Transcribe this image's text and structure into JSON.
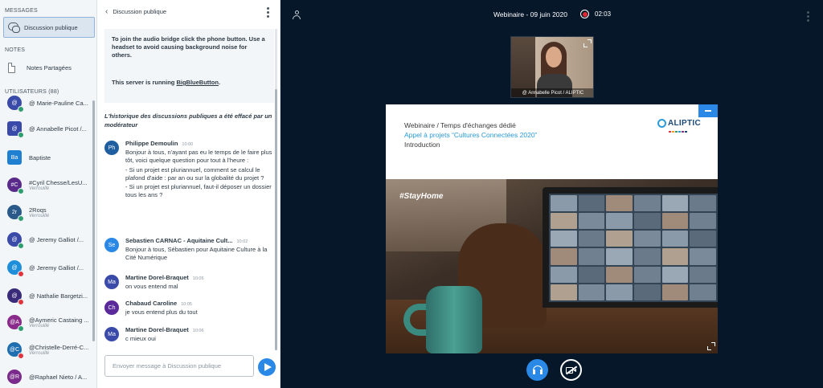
{
  "sidebar": {
    "messages_title": "MESSAGES",
    "public_chat_label": "Discussion publique",
    "notes_title": "NOTES",
    "shared_notes_label": "Notes Partagées",
    "users_title": "UTILISATEURS (88)",
    "users": [
      {
        "initials": "@",
        "name": "@ Marie-Pauline Ca...",
        "role": "",
        "color": "#3a4aa8",
        "badge_color": "#2f9e6e",
        "square": false
      },
      {
        "initials": "@",
        "name": "@ Annabelle Picot /...",
        "role": "",
        "color": "#3a4aa8",
        "badge_color": "#2f9e6e",
        "square": true
      },
      {
        "initials": "Ba",
        "name": "Baptiste",
        "role": "",
        "color": "#1f7fd1",
        "badge_color": "",
        "square": true
      },
      {
        "initials": "#C",
        "name": "#Cyril Chesse/LesU...",
        "role": "Verrouillé",
        "color": "#5a2a8a",
        "badge_color": "#2f9e6e",
        "square": false
      },
      {
        "initials": "2r",
        "name": "2Roqs",
        "role": "Verrouillé",
        "color": "#2a5a8a",
        "badge_color": "#2f9e6e",
        "square": false
      },
      {
        "initials": "@",
        "name": "@ Jeremy Galliot /...",
        "role": "",
        "color": "#3a4aa8",
        "badge_color": "#2f9e6e",
        "square": false
      },
      {
        "initials": "@",
        "name": "@ Jeremy Galliot /...",
        "role": "",
        "color": "#1f8fd9",
        "badge_color": "#e0353d",
        "square": false
      },
      {
        "initials": "@",
        "name": "@ Nathalie Bargetzi...",
        "role": "",
        "color": "#3a2a7a",
        "badge_color": "#e0353d",
        "square": false
      },
      {
        "initials": "@A",
        "name": "@Aymeric Castaing ...",
        "role": "Verrouillé",
        "color": "#8a2a8a",
        "badge_color": "#2f9e6e",
        "square": false
      },
      {
        "initials": "@C",
        "name": "@Christelle-Derré-C...",
        "role": "Verrouillé",
        "color": "#1f6fb0",
        "badge_color": "#e0353d",
        "square": false
      },
      {
        "initials": "@R",
        "name": "@Raphael Nieto / A...",
        "role": "",
        "color": "#7a2a8a",
        "badge_color": "",
        "square": false
      }
    ]
  },
  "chat": {
    "title": "Discussion publique",
    "welcome_line1": "To join the audio bridge click the phone button. Use a headset to avoid causing background noise for others.",
    "welcome_prefix": "This server is running ",
    "welcome_link": "BigBlueButton",
    "welcome_suffix": ".",
    "cleared_notice": "L'historique des discussions publiques a été effacé par un modérateur",
    "messages": [
      {
        "initials": "Ph",
        "author": "Philippe Demoulin",
        "time": "10:00",
        "color": "#1f5fa0",
        "paragraphs": [
          "Bonjour à tous, n'ayant pas eu le temps de le faire plus tôt, voici quelque question pour tout à l'heure :",
          "- Si un projet est pluriannuel, comment se calcul le plafond d'aide : par an ou sur la globalité du projet ?",
          "- Si un projet est pluriannuel, faut-il déposer un dossier tous les ans ?"
        ]
      },
      {
        "initials": "Se",
        "author": "Sebastien CARNAC - Aquitaine Cult...",
        "time": "10:02",
        "color": "#2a89e6",
        "paragraphs": [
          "Bonjour à tous, Sébastien pour Aquitaine Culture à la Cité Numérique"
        ]
      },
      {
        "initials": "Ma",
        "author": "Martine Dorel-Braquet",
        "time": "10:05",
        "color": "#3a4aa8",
        "paragraphs": [
          "on vous entend mal"
        ]
      },
      {
        "initials": "Ch",
        "author": "Chabaud Caroline",
        "time": "10:05",
        "color": "#5a2a9a",
        "paragraphs": [
          "je vous entend plus du tout"
        ]
      },
      {
        "initials": "Ma",
        "author": "Martine Dorel-Braquet",
        "time": "10:06",
        "color": "#3a4aa8",
        "paragraphs": [
          "c mieux oui"
        ]
      }
    ],
    "input_placeholder": "Envoyer message à Discussion publique"
  },
  "stage": {
    "meeting_title": "Webinaire - 09 juin 2020",
    "recording_time": "02:03",
    "webcam_caption": "@ Annabelle Picot / ALIPTIC",
    "slide": {
      "title": "Webinaire / Temps d'échanges dédié",
      "subtitle": "Appel à projets “Cultures Connectées 2020”",
      "intro": "Introduction",
      "logo_text": "ALIPTIC",
      "hashtag": "#StayHome"
    }
  }
}
